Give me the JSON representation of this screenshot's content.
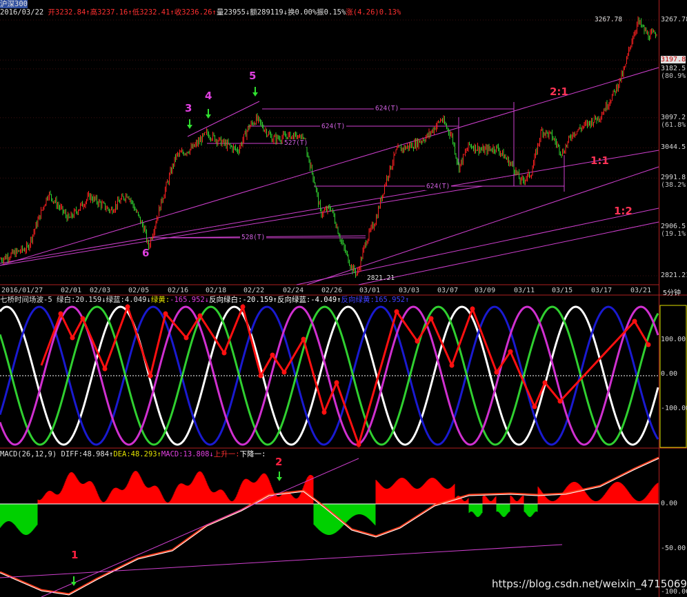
{
  "window": {
    "title": "沪深300",
    "period": "5分钟"
  },
  "header_price": {
    "date": "2016/03/22",
    "fields": [
      {
        "text": "开3232.84",
        "arrow": "↑",
        "color": "#ff3030"
      },
      {
        "text": "高3237.16",
        "arrow": "↑",
        "color": "#ff3030"
      },
      {
        "text": "低3232.41",
        "arrow": "↑",
        "color": "#ff3030"
      },
      {
        "text": "收3236.26",
        "arrow": "↑",
        "color": "#ff3030"
      },
      {
        "text": "量23955",
        "arrow": "↓",
        "color": "#e0e0e0"
      },
      {
        "text": "额289119",
        "arrow": "↓",
        "color": "#e0e0e0"
      },
      {
        "text": "换0.00%",
        "arrow": "",
        "color": "#e0e0e0"
      },
      {
        "text": "振0.15%",
        "arrow": "",
        "color": "#e0e0e0"
      },
      {
        "text": "涨",
        "arrow": "",
        "color": "#ff3030"
      },
      {
        "text": "(4.26)0.13%",
        "arrow": "",
        "color": "#ff3030"
      }
    ]
  },
  "header_wave": {
    "title": "七桥时间场波-5",
    "fields": [
      {
        "text": "绿白:20.159",
        "arrow": "↓",
        "color": "#e0e0e0"
      },
      {
        "text": "绿蓝:4.049",
        "arrow": "↓",
        "color": "#e0e0e0"
      },
      {
        "text": "绿黄:",
        "arrow": "",
        "color": "#e0e000"
      },
      {
        "text": "-165.952",
        "arrow": "↓",
        "color": "#e040e0"
      },
      {
        "text": "反向绿白:-20.159",
        "arrow": "↑",
        "color": "#ffffff"
      },
      {
        "text": "反向绿蓝:-4.049",
        "arrow": "↑",
        "color": "#ffffff"
      },
      {
        "text": "反向绿黄:165.952",
        "arrow": "↑",
        "color": "#4040ff"
      }
    ]
  },
  "header_macd": {
    "title": "MACD(26,12,9)",
    "fields": [
      {
        "text": "DIFF:48.984",
        "arrow": "↑",
        "color": "#e0e0e0"
      },
      {
        "text": "DEA:48.293",
        "arrow": "↑",
        "color": "#e0e000"
      },
      {
        "text": "MACD:13.808",
        "arrow": "↓",
        "color": "#e040e0"
      },
      {
        "text": "上升一:",
        "arrow": "",
        "color": "#ff3030"
      },
      {
        "text": "下降一:",
        "arrow": "",
        "color": "#ffffff"
      }
    ]
  },
  "price_axis": [
    {
      "label": "3267.78",
      "value": 3267.78
    },
    {
      "label": "3197.8",
      "value": 3197.8,
      "highlight": true
    },
    {
      "label": "3182.5",
      "value": 3182.5,
      "pct": "(80.9%)"
    },
    {
      "label": "3097.2",
      "value": 3097.2,
      "pct": "(61.8%)"
    },
    {
      "label": "3044.5",
      "value": 3044.5
    },
    {
      "label": "2991.8",
      "value": 2991.8,
      "pct": "(38.2%)"
    },
    {
      "label": "2906.5",
      "value": 2906.5,
      "pct": "(19.1%)"
    },
    {
      "label": "2821.21",
      "value": 2821.21
    }
  ],
  "wave_axis": [
    "100.00",
    "0.00",
    "-100.00"
  ],
  "macd_axis": [
    "0.00",
    "-50.00",
    "-100.00"
  ],
  "date_axis": [
    "2016/01/27",
    "02/01",
    "02/03",
    "02/05",
    "02/16",
    "02/18",
    "02/22",
    "02/24",
    "02/26",
    "03/01",
    "03/03",
    "03/07",
    "03/09",
    "03/11",
    "03/15",
    "03/17",
    "03/21"
  ],
  "annotations": {
    "high_label": "3267.78",
    "low_label": "2821.21",
    "horizontal_spans": [
      "624(T)",
      "624(T)",
      "527(T)",
      "624(T)",
      "528(T)"
    ],
    "ratios": [
      "2:1",
      "1:1",
      "1:2"
    ],
    "wave_points": [
      "3",
      "4",
      "5",
      "6"
    ],
    "macd_points": [
      "1",
      "2"
    ]
  },
  "watermark": "https://blog.csdn.net/weixin_47150696",
  "colors": {
    "up_candle": "#ff2020",
    "down_candle": "#30d030",
    "trendline": "#d040d0",
    "wave_white": "#ffffff",
    "wave_blue": "#1a1ad0",
    "wave_green": "#30d030",
    "wave_magenta": "#d030d0",
    "zigzag": "#ff1010",
    "macd_pos": "#ff0000",
    "macd_neg": "#00d000",
    "axis_border": "#e0e000"
  },
  "chart_data": {
    "type": "line",
    "title": "沪深300",
    "x": [
      "2016/01/27",
      "02/01",
      "02/03",
      "02/05",
      "02/16",
      "02/18",
      "02/22",
      "02/24",
      "02/26",
      "03/01",
      "03/03",
      "03/07",
      "03/09",
      "03/11",
      "03/15",
      "03/17",
      "03/21"
    ],
    "series": [
      {
        "name": "沪深300",
        "values": [
          2850,
          2960,
          2935,
          2960,
          3020,
          3065,
          3090,
          3050,
          2900,
          2830,
          3005,
          3065,
          3030,
          2995,
          3085,
          3120,
          3240
        ]
      }
    ],
    "ylim": [
      2821.21,
      3267.78
    ],
    "fib_levels": [
      {
        "pct": "80.9%",
        "value": 3182.5
      },
      {
        "pct": "61.8%",
        "value": 3097.2
      },
      {
        "pct": "38.2%",
        "value": 2991.8
      },
      {
        "pct": "19.1%",
        "value": 2906.5
      }
    ],
    "macd": {
      "DIFF": 48.984,
      "DEA": 48.293,
      "MACD": 13.808,
      "ylim": [
        -100,
        0
      ]
    },
    "wave": {
      "green_white": 20.159,
      "green_blue": 4.049,
      "green_yellow": -165.952,
      "ylim": [
        -100,
        100
      ]
    }
  }
}
